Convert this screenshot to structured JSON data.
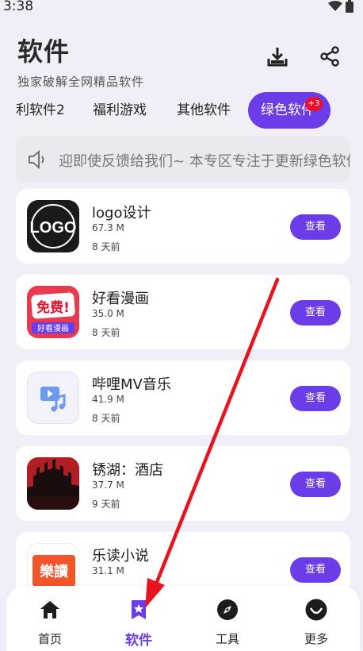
{
  "status_bar": {
    "time": "3:38"
  },
  "header": {
    "title": "软件",
    "subtitle": "独家破解全网精品软件"
  },
  "tabs": [
    {
      "label": "利软件2"
    },
    {
      "label": "福利游戏"
    },
    {
      "label": "其他软件"
    },
    {
      "label": "绿色软件",
      "badge": "+3",
      "active": true
    }
  ],
  "notice": {
    "text": "迎即使反馈给我们~   本专区专注于更新绿色软件"
  },
  "apps": [
    {
      "name": "logo设计",
      "size": "67.3 M",
      "time": "8 天前",
      "button": "查看",
      "icon": "logo-design-icon",
      "icon_text": "LOGO"
    },
    {
      "name": "好看漫画",
      "size": "35.0 M",
      "time": "8 天前",
      "button": "查看",
      "icon": "manga-app-icon",
      "icon_text": "免费!",
      "icon_sub": "好看漫画"
    },
    {
      "name": "哔哩MV音乐",
      "size": "41.9 M",
      "time": "8 天前",
      "button": "查看",
      "icon": "music-video-icon"
    },
    {
      "name": "锈湖：酒店",
      "size": "37.7 M",
      "time": "9 天前",
      "button": "查看",
      "icon": "rusty-lake-hotel-icon"
    },
    {
      "name": "乐读小说",
      "size": "31.1 M",
      "time": "",
      "button": "查看",
      "icon": "novel-reader-icon",
      "icon_text": "樂讀"
    }
  ],
  "bottom_nav": [
    {
      "label": "首页",
      "icon": "home-icon"
    },
    {
      "label": "软件",
      "icon": "software-icon",
      "active": true
    },
    {
      "label": "工具",
      "icon": "compass-icon"
    },
    {
      "label": "更多",
      "icon": "more-icon"
    }
  ],
  "colors": {
    "accent": "#6a3de8",
    "badge": "#e8102e",
    "arrow": "#e8131f",
    "background": "#f2eef7"
  }
}
